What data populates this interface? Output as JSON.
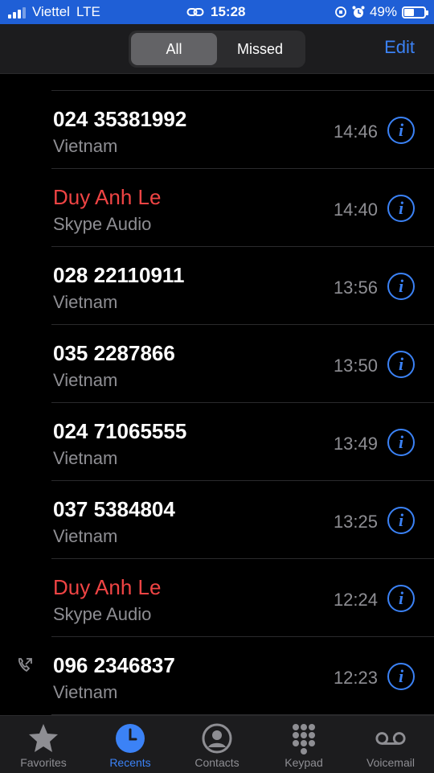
{
  "status_bar": {
    "carrier": "Viettel",
    "network": "LTE",
    "time": "15:28",
    "battery": "49%",
    "battery_level": 0.49
  },
  "header": {
    "segments": [
      {
        "label": "All",
        "active": true
      },
      {
        "label": "Missed",
        "active": false
      }
    ],
    "edit_label": "Edit"
  },
  "calls": [
    {
      "name": "024 35381992",
      "subtitle": "Vietnam",
      "time": "14:46",
      "missed": false,
      "outgoing": false
    },
    {
      "name": "Duy Anh Le",
      "subtitle": "Skype Audio",
      "time": "14:40",
      "missed": true,
      "outgoing": false
    },
    {
      "name": "028 22110911",
      "subtitle": "Vietnam",
      "time": "13:56",
      "missed": false,
      "outgoing": false
    },
    {
      "name": "035 2287866",
      "subtitle": "Vietnam",
      "time": "13:50",
      "missed": false,
      "outgoing": false
    },
    {
      "name": "024 71065555",
      "subtitle": "Vietnam",
      "time": "13:49",
      "missed": false,
      "outgoing": false
    },
    {
      "name": "037 5384804",
      "subtitle": "Vietnam",
      "time": "13:25",
      "missed": false,
      "outgoing": false
    },
    {
      "name": "Duy Anh Le",
      "subtitle": "Skype Audio",
      "time": "12:24",
      "missed": true,
      "outgoing": false
    },
    {
      "name": "096 2346837",
      "subtitle": "Vietnam",
      "time": "12:23",
      "missed": false,
      "outgoing": true
    }
  ],
  "tabs": [
    {
      "label": "Favorites",
      "icon": "star-icon",
      "active": false
    },
    {
      "label": "Recents",
      "icon": "clock-icon",
      "active": true
    },
    {
      "label": "Contacts",
      "icon": "person-icon",
      "active": false
    },
    {
      "label": "Keypad",
      "icon": "keypad-icon",
      "active": false
    },
    {
      "label": "Voicemail",
      "icon": "voicemail-icon",
      "active": false
    }
  ],
  "colors": {
    "accent": "#3b82f6",
    "missed": "#ef4444",
    "status_bar": "#1f5fd6"
  }
}
